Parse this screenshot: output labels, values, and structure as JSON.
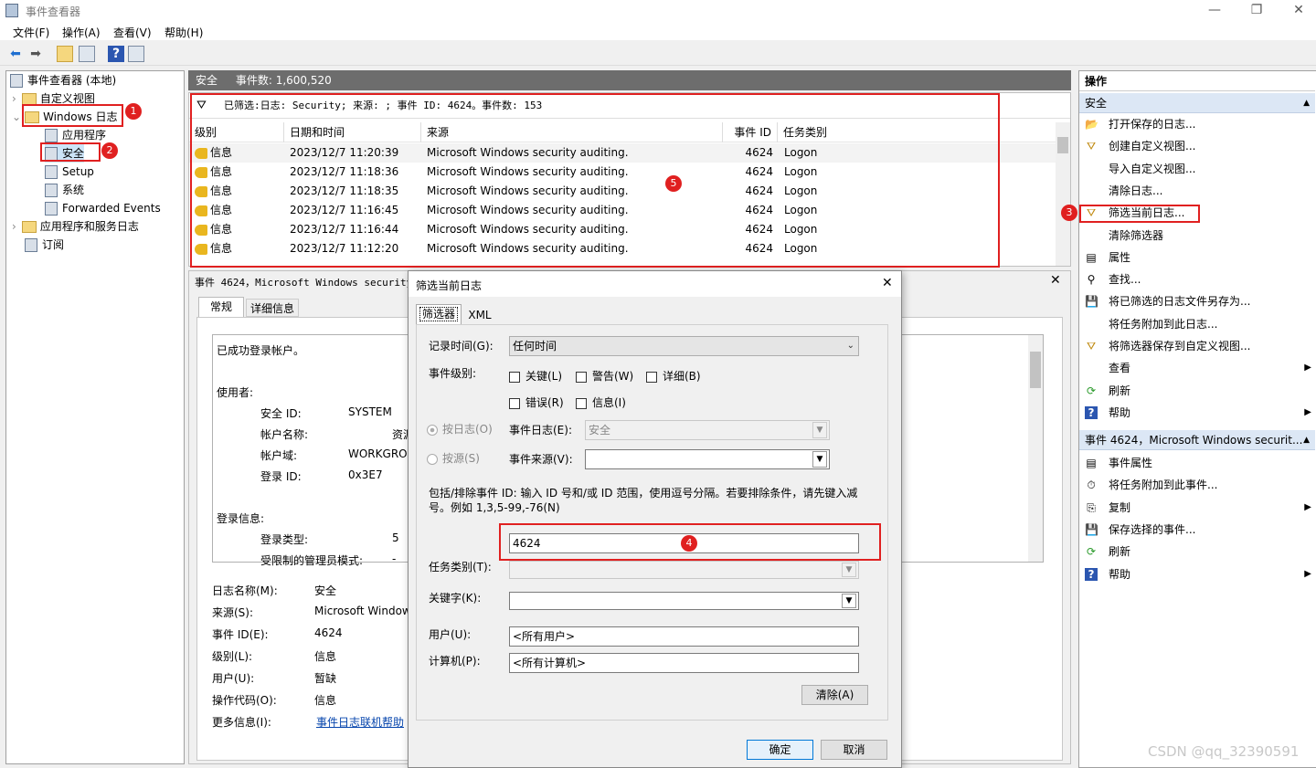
{
  "window": {
    "title": "事件查看器",
    "min": "—",
    "max": "❐",
    "close": "✕"
  },
  "menu": [
    "文件(F)",
    "操作(A)",
    "查看(V)",
    "帮助(H)"
  ],
  "tree": {
    "root": "事件查看器 (本地)",
    "custom_views": "自定义视图",
    "windows_logs": "Windows 日志",
    "app": "应用程序",
    "security": "安全",
    "setup": "Setup",
    "system": "系统",
    "forwarded": "Forwarded Events",
    "app_service_logs": "应用程序和服务日志",
    "subscriptions": "订阅"
  },
  "center": {
    "header_name": "安全",
    "header_count": "事件数: 1,600,520",
    "filter_text": "已筛选:日志: Security; 来源: ; 事件 ID: 4624。事件数: 153",
    "columns": [
      "级别",
      "日期和时间",
      "来源",
      "事件 ID",
      "任务类别"
    ],
    "rows": [
      {
        "level": "信息",
        "datetime": "2023/12/7 11:20:39",
        "source": "Microsoft Windows security auditing.",
        "id": "4624",
        "task": "Logon"
      },
      {
        "level": "信息",
        "datetime": "2023/12/7 11:18:36",
        "source": "Microsoft Windows security auditing.",
        "id": "4624",
        "task": "Logon"
      },
      {
        "level": "信息",
        "datetime": "2023/12/7 11:18:35",
        "source": "Microsoft Windows security auditing.",
        "id": "4624",
        "task": "Logon"
      },
      {
        "level": "信息",
        "datetime": "2023/12/7 11:16:45",
        "source": "Microsoft Windows security auditing.",
        "id": "4624",
        "task": "Logon"
      },
      {
        "level": "信息",
        "datetime": "2023/12/7 11:16:44",
        "source": "Microsoft Windows security auditing.",
        "id": "4624",
        "task": "Logon"
      },
      {
        "level": "信息",
        "datetime": "2023/12/7 11:12:20",
        "source": "Microsoft Windows security auditing.",
        "id": "4624",
        "task": "Logon"
      }
    ]
  },
  "detail": {
    "title": "事件 4624，Microsoft Windows security a",
    "tab_general": "常规",
    "tab_details": "详细信息",
    "message": "已成功登录帐户。",
    "subject": "使用者:",
    "sid_label": "安全 ID:",
    "sid_value": "SYSTEM",
    "account_label": "帐户名称:",
    "account_value": "资源",
    "domain_label": "帐户域:",
    "domain_value": "WORKGRO",
    "logon_id_label": "登录 ID:",
    "logon_id_value": "0x3E7",
    "logon_info": "登录信息:",
    "logon_type_label": "登录类型:",
    "logon_type_value": "5",
    "restricted_label": "受限制的管理员模式:",
    "restricted_value": "-",
    "log_name_label": "日志名称(M):",
    "log_name_value": "安全",
    "source_label": "来源(S):",
    "source_value": "Microsoft Window",
    "event_id_label": "事件 ID(E):",
    "event_id_value": "4624",
    "level_label": "级别(L):",
    "level_value": "信息",
    "user_label": "用户(U):",
    "user_value": "暂缺",
    "opcode_label": "操作代码(O):",
    "opcode_value": "信息",
    "more_label": "更多信息(I):",
    "more_link": "事件日志联机帮助"
  },
  "dialog": {
    "title": "筛选当前日志",
    "tab_filter": "筛选器",
    "tab_xml": "XML",
    "logged_label": "记录时间(G):",
    "logged_value": "任何时间",
    "level_label": "事件级别:",
    "critical": "关键(L)",
    "warning": "警告(W)",
    "verbose": "详细(B)",
    "error": "错误(R)",
    "info": "信息(I)",
    "by_log": "按日志(O)",
    "by_source": "按源(S)",
    "event_log_label": "事件日志(E):",
    "event_log_value": "安全",
    "event_source_label": "事件来源(V):",
    "include_text": "包括/排除事件 ID: 输入 ID 号和/或 ID 范围，使用逗号分隔。若要排除条件，请先键入减号。例如 1,3,5-99,-76(N)",
    "event_id_value": "4624",
    "task_label": "任务类别(T):",
    "keywords_label": "关键字(K):",
    "user_label": "用户(U):",
    "user_value": "<所有用户>",
    "computer_label": "计算机(P):",
    "computer_value": "<所有计算机>",
    "clear": "清除(A)",
    "ok": "确定",
    "cancel": "取消"
  },
  "actions": {
    "title": "操作",
    "section1": "安全",
    "items1": [
      "打开保存的日志...",
      "创建自定义视图...",
      "导入自定义视图...",
      "清除日志...",
      "筛选当前日志...",
      "清除筛选器",
      "属性",
      "查找...",
      "将已筛选的日志文件另存为...",
      "将任务附加到此日志...",
      "将筛选器保存到自定义视图...",
      "查看",
      "刷新",
      "帮助"
    ],
    "section2": "事件 4624，Microsoft Windows securit...",
    "items2": [
      "事件属性",
      "将任务附加到此事件...",
      "复制",
      "保存选择的事件...",
      "刷新",
      "帮助"
    ]
  },
  "badges": [
    "1",
    "2",
    "3",
    "4",
    "5"
  ],
  "watermark": "CSDN @qq_32390591",
  "colors": {
    "accent": "#e02020",
    "header": "#6d6d6d",
    "section": "#dce7f5"
  }
}
